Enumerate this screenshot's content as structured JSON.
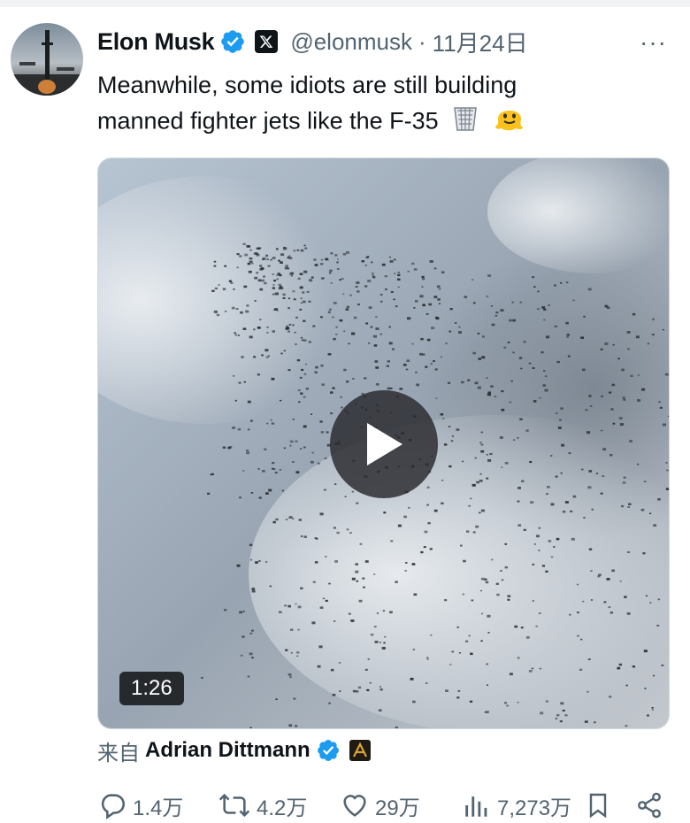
{
  "tweet": {
    "author_name": "Elon Musk",
    "handle": "@elonmusk",
    "separator": "·",
    "date": "11月24日",
    "more": "···",
    "text_line1": "Meanwhile, some idiots are still building",
    "text_line2": "manned fighter jets like the F-35",
    "emojis": [
      "wastebasket-emoji",
      "melting-face-emoji"
    ]
  },
  "video": {
    "duration": "1:26"
  },
  "source": {
    "prefix": "来自",
    "author": "Adrian Dittmann"
  },
  "actions": {
    "replies": "1.4万",
    "reposts": "4.2万",
    "likes": "29万",
    "views": "7,273万"
  },
  "colors": {
    "verified": "#1d9bf0",
    "muted_text": "#536471",
    "text": "#0f1419"
  },
  "icons": [
    "verified-icon",
    "x-logo-icon",
    "more-icon",
    "play-icon",
    "reply-icon",
    "repost-icon",
    "like-icon",
    "views-icon",
    "bookmark-icon",
    "share-icon"
  ]
}
